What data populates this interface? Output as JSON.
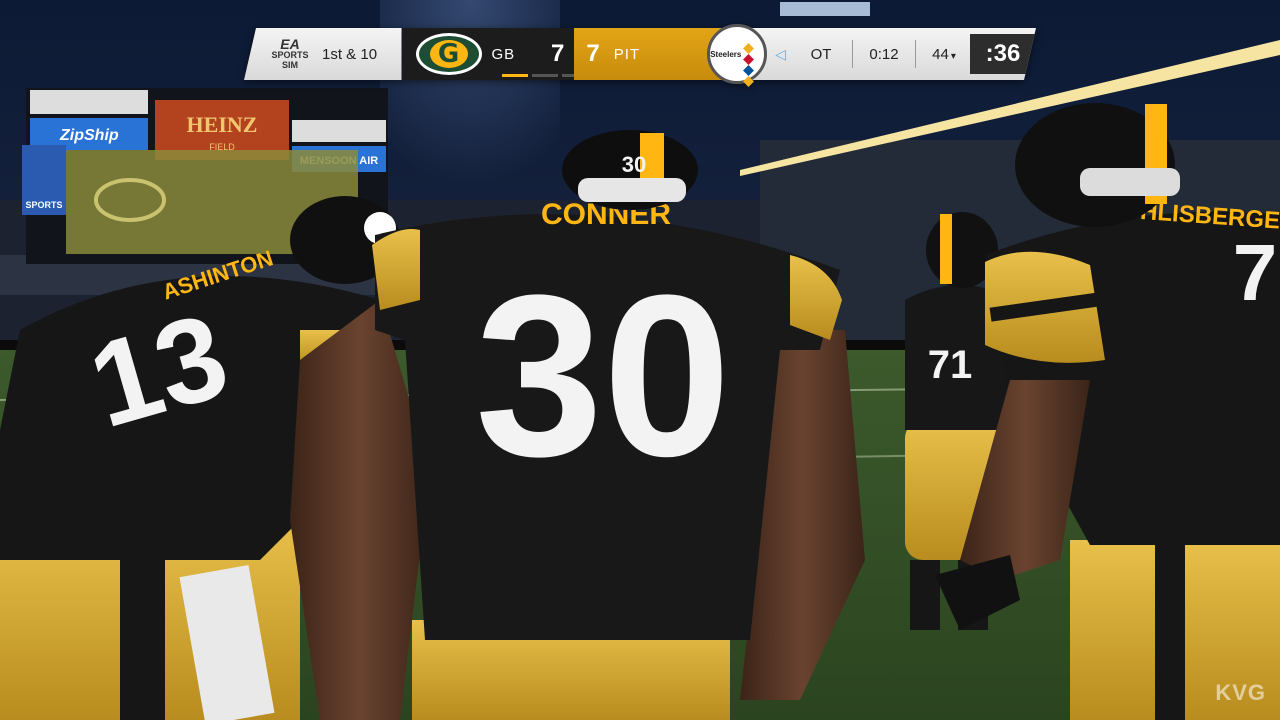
{
  "scorebug": {
    "brand_line1": "EA",
    "brand_line2": "SPORTS",
    "brand_line3": "SIM",
    "down_distance": "1st & 10",
    "home": {
      "abbr": "GB",
      "score": "7",
      "timeouts_remaining": 3,
      "color": "#1d4d32"
    },
    "away": {
      "abbr": "PIT",
      "score": "7",
      "logo_text": "Steelers",
      "color": "#ffb612"
    },
    "quarter": "OT",
    "game_clock": "0:12",
    "play_clock_setting": "44",
    "play_clock": ":36",
    "possession_icon": "left-arrow-icon"
  },
  "stadium": {
    "signs": [
      "ZipShip",
      "HEINZ",
      "FIELD",
      "MENSOON AIR",
      "SPORTS"
    ]
  },
  "players": [
    {
      "name": "",
      "number": "13",
      "nameplate": "ASHINTON"
    },
    {
      "name": "CONNER",
      "number": "30",
      "helmet_number": "30"
    },
    {
      "name": "",
      "number": "71"
    },
    {
      "name": "ROETHLISBERGER",
      "number": "7"
    }
  ],
  "watermark": "KVG",
  "colors": {
    "steelers_black": "#161616",
    "steelers_gold": "#ffb612"
  }
}
